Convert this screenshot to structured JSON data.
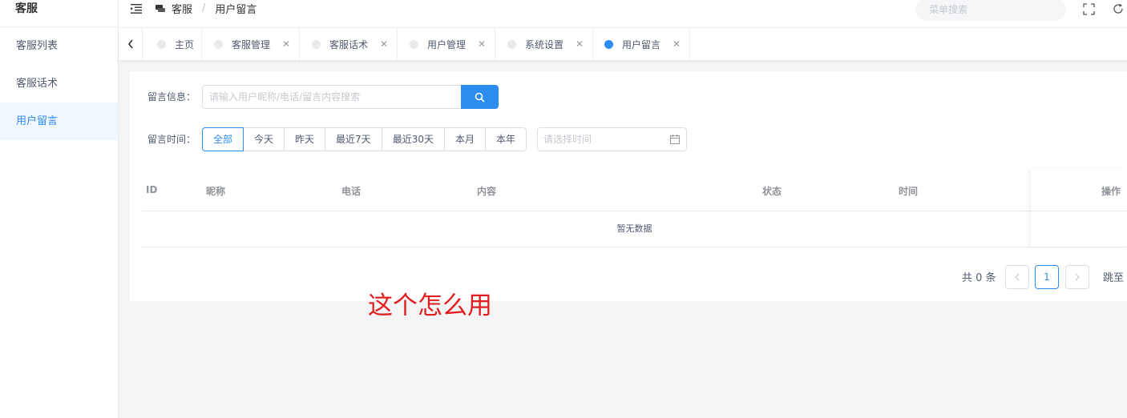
{
  "sidebar": {
    "title": "客服",
    "items": [
      {
        "label": "客服列表"
      },
      {
        "label": "客服话术"
      },
      {
        "label": "用户留言"
      }
    ]
  },
  "header": {
    "breadcrumb": [
      "客服",
      "用户留言"
    ],
    "breadcrumb_separator": "/",
    "search_placeholder": "菜单搜索"
  },
  "tabs": [
    {
      "label": "主页",
      "closable": false
    },
    {
      "label": "客服管理",
      "closable": true
    },
    {
      "label": "客服话术",
      "closable": true
    },
    {
      "label": "用户管理",
      "closable": true
    },
    {
      "label": "系统设置",
      "closable": true
    },
    {
      "label": "用户留言",
      "closable": true,
      "active": true
    }
  ],
  "filters": {
    "message_label": "留言信息：",
    "message_placeholder": "请输入用户昵称/电话/留言内容搜索",
    "time_label": "留言时间：",
    "time_options": [
      "全部",
      "今天",
      "昨天",
      "最近7天",
      "最近30天",
      "本月",
      "本年"
    ],
    "time_selected": "全部",
    "date_placeholder": "请选择时间"
  },
  "table": {
    "columns": [
      "ID",
      "昵称",
      "电话",
      "内容",
      "状态",
      "时间",
      "操作"
    ],
    "rows": [],
    "empty_text": "暂无数据"
  },
  "pagination": {
    "total_text": "共 0 条",
    "current_page": "1",
    "jump_text": "跳至"
  },
  "annotation": "这个怎么用",
  "colors": {
    "primary": "#2d8cf0",
    "annotation": "#e02020"
  }
}
